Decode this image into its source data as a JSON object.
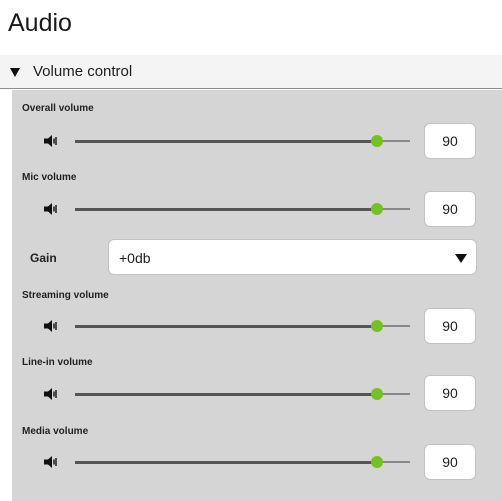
{
  "page": {
    "title": "Audio"
  },
  "section": {
    "title": "Volume control",
    "expanded": true
  },
  "colors": {
    "slider_thumb": "#76c122",
    "panel_bg": "#d5d5d5"
  },
  "controls": {
    "overall": {
      "label": "Overall volume",
      "value": 90,
      "value_text": "90",
      "icon": "speaker-icon"
    },
    "mic": {
      "label": "Mic volume",
      "value": 90,
      "value_text": "90",
      "icon": "speaker-icon"
    },
    "streaming": {
      "label": "Streaming volume",
      "value": 90,
      "value_text": "90",
      "icon": "speaker-icon"
    },
    "linein": {
      "label": "Line-in volume",
      "value": 90,
      "value_text": "90",
      "icon": "speaker-icon"
    },
    "media": {
      "label": "Media volume",
      "value": 90,
      "value_text": "90",
      "icon": "speaker-icon"
    }
  },
  "gain": {
    "label": "Gain",
    "value": "+0db",
    "icon": "chevron-down-icon"
  }
}
